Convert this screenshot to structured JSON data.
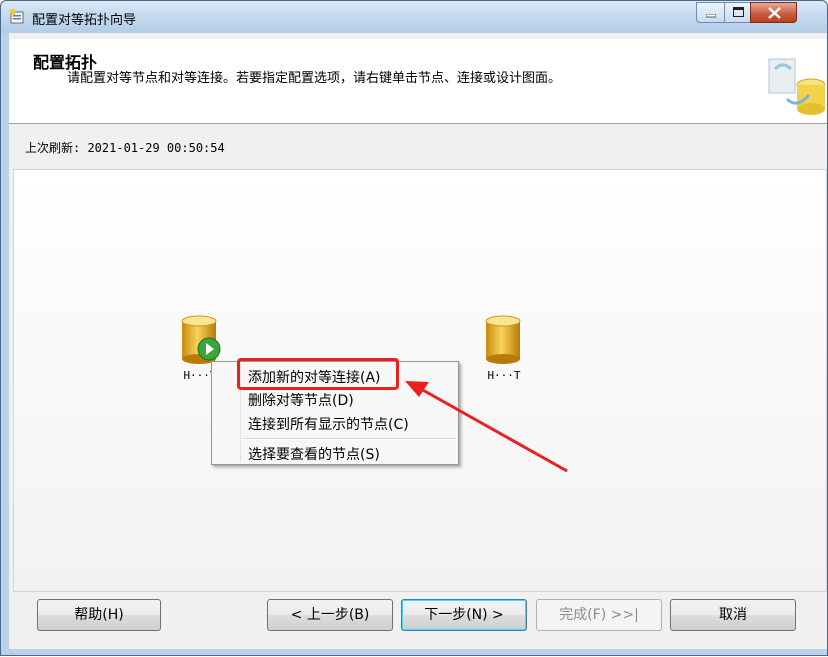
{
  "window": {
    "title": "配置对等拓扑向导"
  },
  "header": {
    "title": "配置拓扑",
    "subtitle": "请配置对等节点和对等连接。若要指定配置选项，请右键单击节点、连接或设计图面。"
  },
  "refresh": {
    "text": "上次刷新: 2021-01-29 00:50:54"
  },
  "nodes": [
    {
      "label": "H···T"
    },
    {
      "label": "H···T"
    }
  ],
  "context_menu": {
    "items": [
      "添加新的对等连接(A)",
      "删除对等节点(D)",
      "连接到所有显示的节点(C)",
      "选择要查看的节点(S)"
    ]
  },
  "buttons": {
    "help": "帮助(H)",
    "back": "< 上一步(B)",
    "next": "下一步(N) >",
    "finish": "完成(F) >>|",
    "cancel": "取消"
  },
  "colors": {
    "annotation": "#e8211f",
    "accent": "#3c7fb1"
  }
}
